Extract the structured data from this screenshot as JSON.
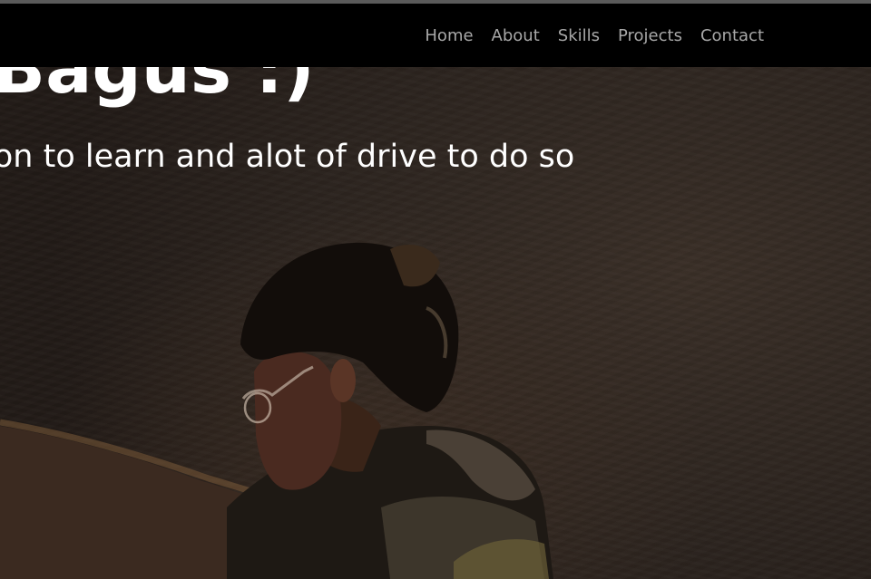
{
  "nav": {
    "links": [
      "Home",
      "About",
      "Skills",
      "Projects",
      "Contact"
    ]
  },
  "hero": {
    "headline": "Hi, I'm Bagus :)",
    "subline": "I have a passion to learn and alot of drive to do so"
  },
  "colors": {
    "navbar_bg": "#000000",
    "nav_link": "#a8a8a8",
    "hero_text": "#ffffff",
    "hero_bg": "#2c241f"
  },
  "icons": [
    "person-photo"
  ]
}
